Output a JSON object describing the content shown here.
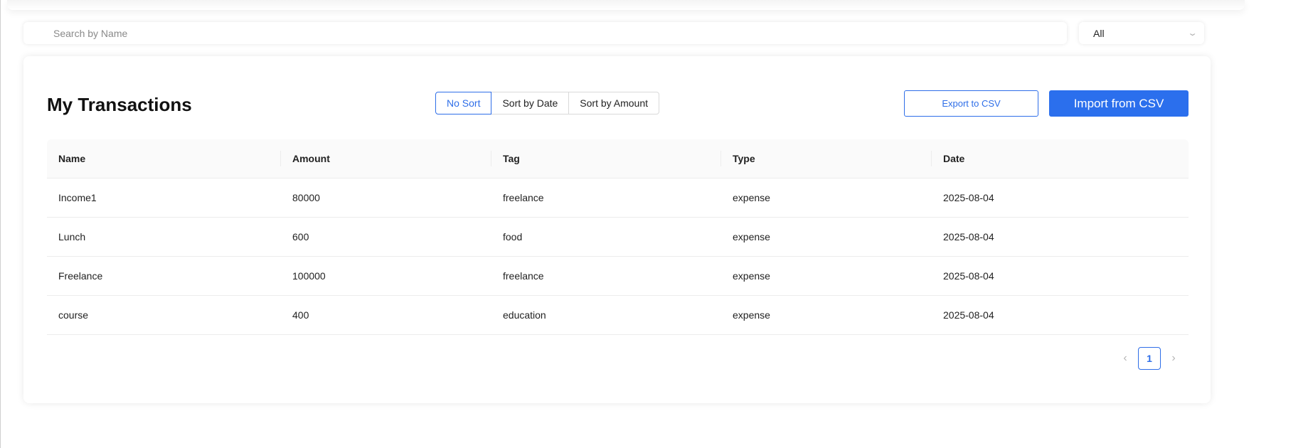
{
  "search": {
    "placeholder": "Search by Name",
    "value": ""
  },
  "filter": {
    "selected": "All",
    "icon": "chevron-down-icon"
  },
  "card": {
    "title": "My Transactions",
    "sort_options": [
      "No Sort",
      "Sort by Date",
      "Sort by Amount"
    ],
    "active_sort": "No Sort",
    "export_label": "Export to CSV",
    "import_label": "Import from CSV"
  },
  "table": {
    "columns": [
      "Name",
      "Amount",
      "Tag",
      "Type",
      "Date"
    ],
    "rows": [
      [
        "Income1",
        "80000",
        "freelance",
        "expense",
        "2025-08-04"
      ],
      [
        "Lunch",
        "600",
        "food",
        "expense",
        "2025-08-04"
      ],
      [
        "Freelance",
        "100000",
        "freelance",
        "expense",
        "2025-08-04"
      ],
      [
        "course",
        "400",
        "education",
        "expense",
        "2025-08-04"
      ]
    ]
  },
  "pagination": {
    "prev_icon": "chevron-left-icon",
    "next_icon": "chevron-right-icon",
    "current_page": "1"
  },
  "colors": {
    "accent": "#2b6fed",
    "border": "#d9d9d9",
    "header_bg": "#fafafa"
  }
}
